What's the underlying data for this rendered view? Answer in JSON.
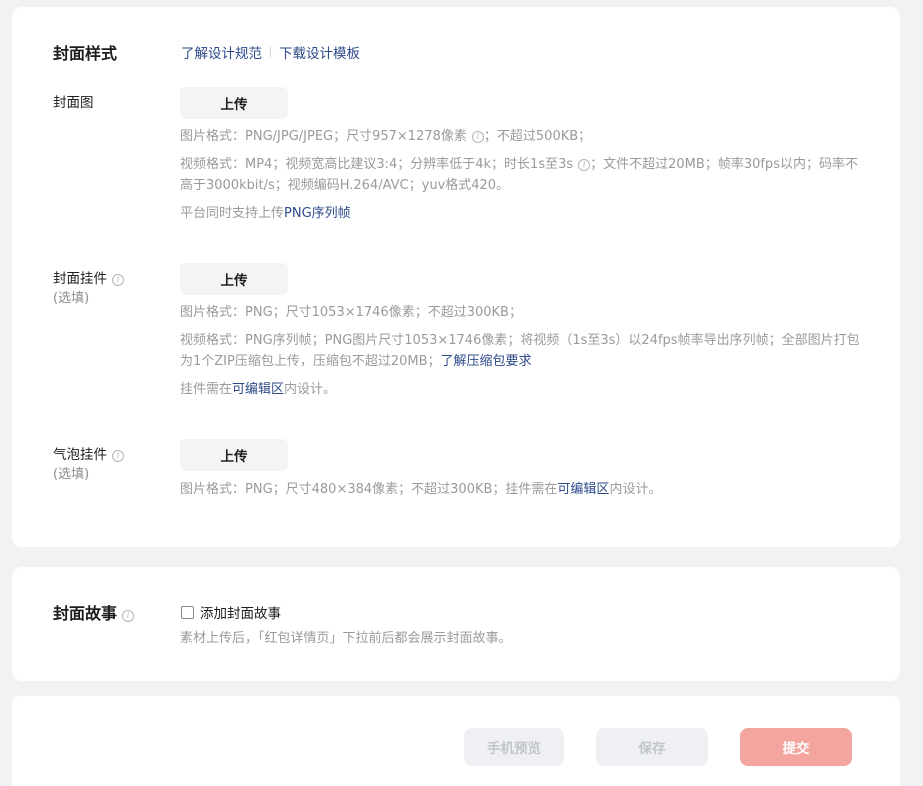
{
  "cover_style": {
    "title": "封面样式",
    "links": [
      "了解设计规范",
      "下载设计模板"
    ],
    "cover_image": {
      "label": "封面图",
      "upload_label": "上传",
      "image_hint_a": "图片格式：PNG/JPG/JPEG；尺寸957×1278像素",
      "image_hint_b": "；不超过500KB；",
      "video_hint_a": "视频格式：MP4；视频宽高比建议3:4；分辨率低于4k；时长1s至3s",
      "video_hint_b": "；文件不超过20MB；帧率30fps以内；码率不高于3000kbit/s；视频编码H.264/AVC；yuv格式420。",
      "png_hint_prefix": "平台同时支持上传",
      "png_hint_link": "PNG序列帧"
    },
    "cover_pendant": {
      "label": "封面挂件",
      "optional": "(选填)",
      "upload_label": "上传",
      "image_hint": "图片格式：PNG；尺寸1053×1746像素；不超过300KB；",
      "video_hint": "视频格式：PNG序列帧；PNG图片尺寸1053×1746像素；将视频（1s至3s）以24fps帧率导出序列帧；全部图片打包为1个ZIP压缩包上传，压缩包不超过20MB；",
      "video_hint_link": "了解压缩包要求",
      "edit_hint_prefix": "挂件需在",
      "edit_hint_link": "可编辑区",
      "edit_hint_suffix": "内设计。"
    },
    "bubble_pendant": {
      "label": "气泡挂件",
      "optional": "(选填)",
      "upload_label": "上传",
      "hint_prefix": "图片格式：PNG；尺寸480×384像素；不超过300KB；挂件需在",
      "hint_link": "可编辑区",
      "hint_suffix": "内设计。"
    }
  },
  "cover_story": {
    "title": "封面故事",
    "checkbox_label": "添加封面故事",
    "hint": "素材上传后，「红包详情页」下拉前后都会展示封面故事。"
  },
  "actions": {
    "preview": "手机预览",
    "save": "保存",
    "submit": "提交"
  }
}
